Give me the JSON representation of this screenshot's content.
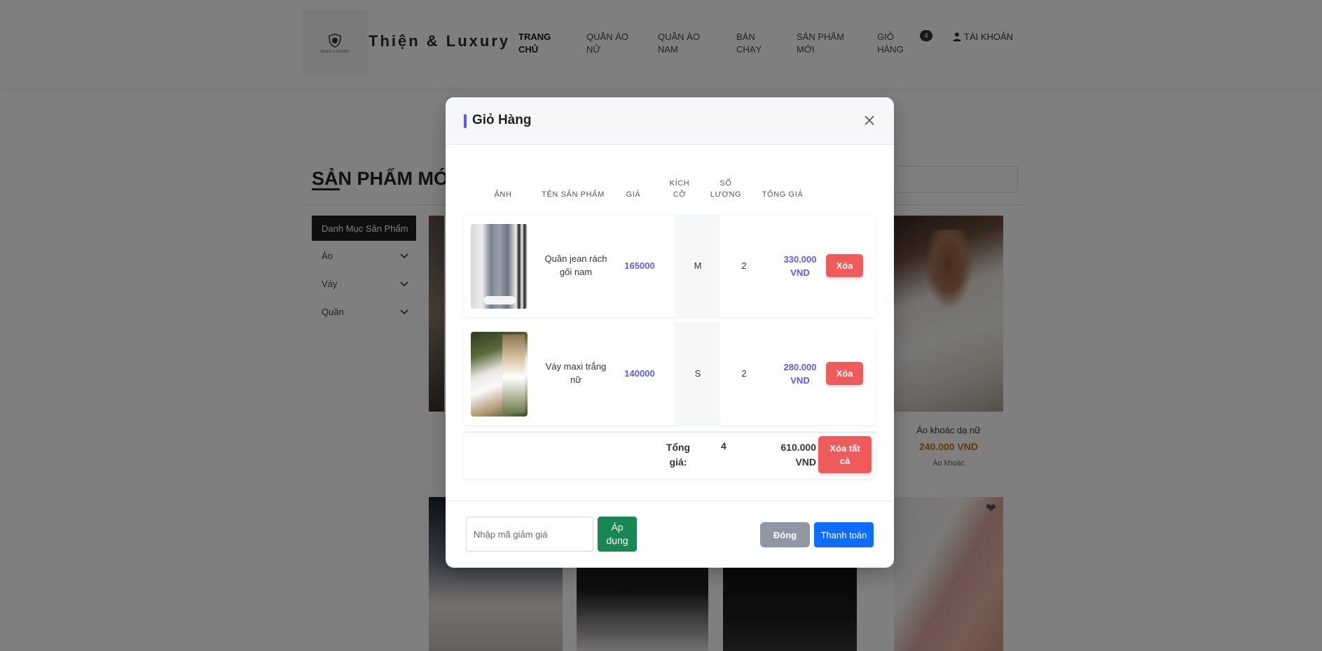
{
  "header": {
    "brand": "Thiện & Luxury",
    "logo_text": "THIEN LUXURY",
    "nav": [
      {
        "label": "TRANG\nCHỦ"
      },
      {
        "label": "QUẦN ÁO\nNỮ"
      },
      {
        "label": "QUẦN ÁO\nNAM"
      },
      {
        "label": "BÁN\nCHẠY"
      },
      {
        "label": "SẢN PHẨM\nMỚI"
      },
      {
        "label": "GIỎ\nHÀNG"
      }
    ],
    "cart_count": "4",
    "account_label": "TÀI KHOẢN"
  },
  "page": {
    "section_title": "SẢN PHẨM MỚ",
    "category_header": "Danh Mục Sản Phẩm",
    "categories": [
      {
        "label": "Áo"
      },
      {
        "label": "Váy"
      },
      {
        "label": "Quần"
      }
    ],
    "visible_card": {
      "name": "Áo khoác dạ nữ",
      "price": "240.000 VND",
      "category": "Áo khoác"
    }
  },
  "modal": {
    "title": "Giỏ Hàng",
    "columns": [
      "ẢNH",
      "TÊN SẢN PHẨM",
      "GIÁ",
      "KÍCH\nCỠ",
      "SỐ\nLƯỢNG",
      "TỔNG GIÁ"
    ],
    "items": [
      {
        "name": "Quần jean rách\ngối nam",
        "price": "165000",
        "size": "M",
        "qty": "2",
        "total": "330.000\nVND",
        "delete_label": "Xóa"
      },
      {
        "name": "Váy maxi trắng\nnữ",
        "price": "140000",
        "size": "S",
        "qty": "2",
        "total": "280.000\nVND",
        "delete_label": "Xóa"
      }
    ],
    "summary": {
      "label": "Tổng\ngiá:",
      "qty": "4",
      "total": "610.000\nVND",
      "delete_all_label": "Xóa tất\ncả"
    },
    "footer": {
      "coupon_placeholder": "Nhập mã giảm giá",
      "apply_label": "Áp\ndụng",
      "close_label": "Đóng",
      "checkout_label": "Thanh toán"
    }
  },
  "colors": {
    "accent": "#5b5ce6",
    "danger": "#ef5b5b",
    "success": "#198754",
    "primary": "#0d6efd",
    "secondary": "#8e97a3"
  }
}
